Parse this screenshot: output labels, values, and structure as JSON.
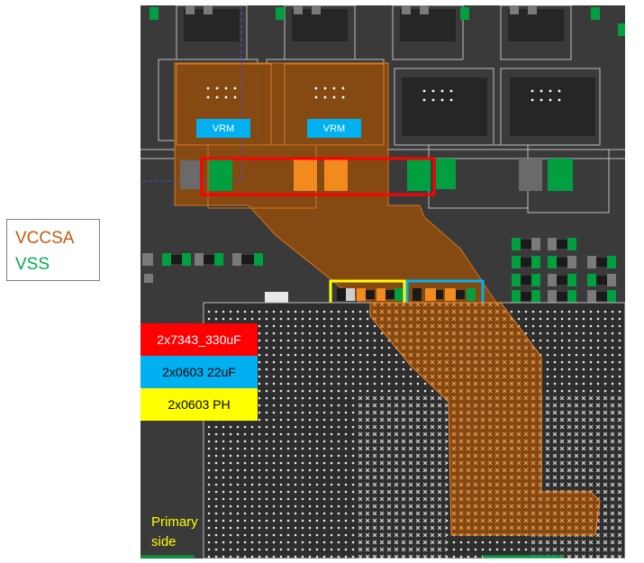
{
  "legend": {
    "vccsa": "VCCSA",
    "vss": "VSS"
  },
  "tags": {
    "red": "2x7343_330uF",
    "blue": "2x0603 22uF",
    "yellow": "2x0603 PH"
  },
  "vrm_labels": [
    "VRM",
    "VRM"
  ],
  "primary": {
    "line1": "Primary",
    "line2": "side"
  },
  "colors": {
    "vccsa": "#c55a11",
    "vss": "#00b050",
    "board": "#3a3a3a",
    "pad_orange": "#f28a1e",
    "pad_green": "#00a040",
    "box_red": "#ff0000",
    "box_blue": "#00b0f0",
    "box_yellow": "#ffff00"
  }
}
